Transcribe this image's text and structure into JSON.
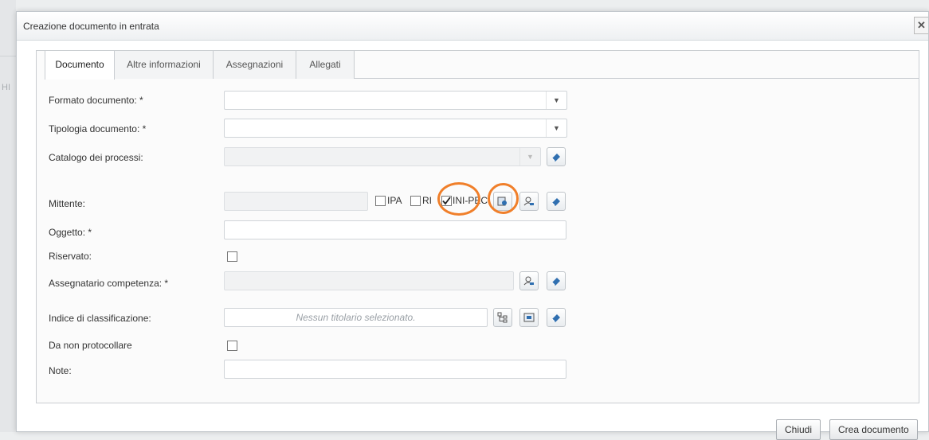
{
  "dialog": {
    "title": "Creazione documento in entrata",
    "close_icon": "close-icon"
  },
  "background": {
    "hint": "HI"
  },
  "tabs": [
    {
      "label": "Documento",
      "active": true
    },
    {
      "label": "Altre informazioni",
      "active": false
    },
    {
      "label": "Assegnazioni",
      "active": false
    },
    {
      "label": "Allegati",
      "active": false
    }
  ],
  "form": {
    "formato_label": "Formato documento: *",
    "formato_value": "",
    "tipologia_label": "Tipologia documento: *",
    "tipologia_value": "",
    "catalogo_label": "Catalogo dei processi:",
    "catalogo_value": "",
    "mittente_label": "Mittente:",
    "mittente_value": "",
    "mittente_options": [
      {
        "label": "IPA",
        "checked": false
      },
      {
        "label": "RI",
        "checked": false
      },
      {
        "label": "INI-PEC",
        "checked": true
      }
    ],
    "oggetto_label": "Oggetto: *",
    "oggetto_value": "",
    "riservato_label": "Riservato:",
    "riservato_checked": false,
    "assegnatario_label": "Assegnatario competenza: *",
    "assegnatario_value": "",
    "indice_label": "Indice di classificazione:",
    "indice_placeholder": "Nessun titolario selezionato.",
    "da_non_protocollare_label": "Da non protocollare",
    "da_non_protocollare_checked": false,
    "note_label": "Note:",
    "note_value": ""
  },
  "footer": {
    "close_label": "Chiudi",
    "create_label": "Crea documento"
  },
  "colors": {
    "highlight_ring": "#f07f2a",
    "icon_blue": "#2f6fb0"
  }
}
